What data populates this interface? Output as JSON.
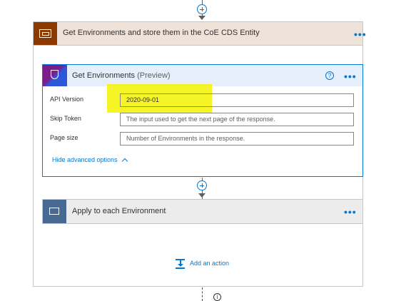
{
  "scope": {
    "title": "Get Environments and store them in the CoE CDS Entity",
    "menu": "•••",
    "icon": "scope-icon",
    "accent_color": "#8c3900"
  },
  "action": {
    "title": "Get Environments",
    "title_suffix": "(Preview)",
    "menu": "•••",
    "help": "?",
    "icon": "shield-icon",
    "fields": [
      {
        "label": "API Version",
        "value": "2020-09-01",
        "placeholder": ""
      },
      {
        "label": "Skip Token",
        "value": "",
        "placeholder": "The input used to get the next page of the response."
      },
      {
        "label": "Page size",
        "value": "",
        "placeholder": "Number of Environments in the response."
      }
    ],
    "advanced_link": "Hide advanced options",
    "highlight_color": "#f2f200"
  },
  "loop": {
    "title": "Apply to each Environment",
    "menu": "•••",
    "icon": "loop-icon",
    "accent_color": "#486991"
  },
  "add_action": {
    "label": "Add an action",
    "icon": "add-action-icon"
  },
  "footer": {
    "info": "i"
  }
}
